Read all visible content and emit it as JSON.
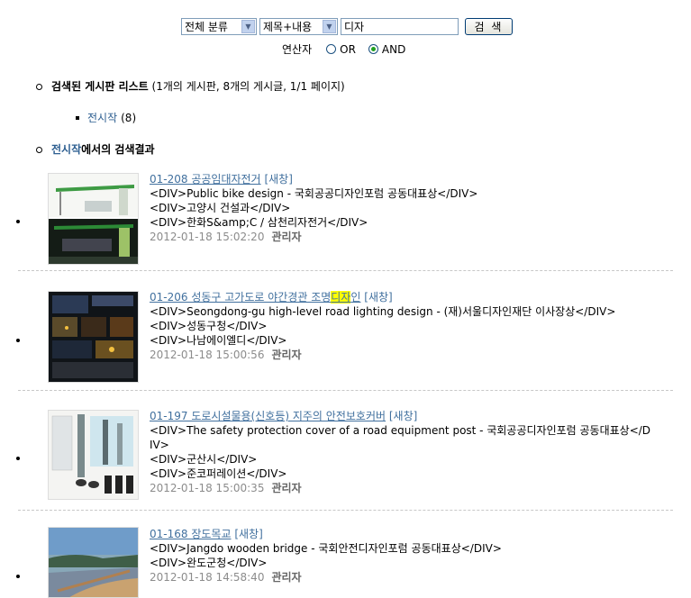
{
  "search": {
    "category_value": "전체 분류",
    "field_value": "제목+내용",
    "query": "디자",
    "button_label": "검 색",
    "operator_label": "연산자",
    "op_or": "OR",
    "op_and": "AND",
    "selected_op": "AND"
  },
  "boards_header": {
    "title": "검색된 게시판 리스트",
    "summary": "(1개의 게시판, 8개의 게시글, 1/1 페이지)"
  },
  "boards": [
    {
      "name": "전시작",
      "count": "(8)"
    }
  ],
  "results_header": {
    "board": "전시작",
    "suffix": "에서의 검색결과"
  },
  "results": [
    {
      "title": "01-208 공공임대자전거",
      "badge": "[새창]",
      "lines": [
        "<DIV>Public bike design - 국회공공디자인포럼 공동대표상</DIV>",
        "<DIV>고양시 건설과</DIV>",
        "<DIV>한화S&amp;C / 삼천리자전거</DIV>"
      ],
      "date": "2012-01-18 15:02:20",
      "author": "관리자"
    },
    {
      "title_pre": "01-206 성동구 고가도로 야간경관 조명",
      "title_hl": "디자",
      "title_post": "인",
      "badge": "[새창]",
      "lines": [
        "<DIV>Seongdong-gu high-level road lighting design - (재)서울디자인재단 이사장상</DIV>",
        "<DIV>성동구청</DIV>",
        "<DIV>나남에이엘디</DIV>"
      ],
      "date": "2012-01-18 15:00:56",
      "author": "관리자"
    },
    {
      "title": "01-197 도로시설물용(신호등) 지주의 안전보호커버",
      "badge": "[새창]",
      "lines": [
        "<DIV>The safety protection cover of a road equipment post - 국회공공디자인포럼 공동대표상</D",
        "IV>",
        "<DIV>군산시</DIV>",
        "<DIV>준코퍼레이션</DIV>"
      ],
      "date": "2012-01-18 15:00:35",
      "author": "관리자"
    },
    {
      "title": "01-168 장도목교",
      "badge": "[새창]",
      "lines": [
        "<DIV>Jangdo wooden bridge - 국회안전디자인포럼 공동대표상</DIV>",
        "<DIV>완도군청</DIV>"
      ],
      "date": "2012-01-18 14:58:40",
      "author": "관리자"
    }
  ]
}
